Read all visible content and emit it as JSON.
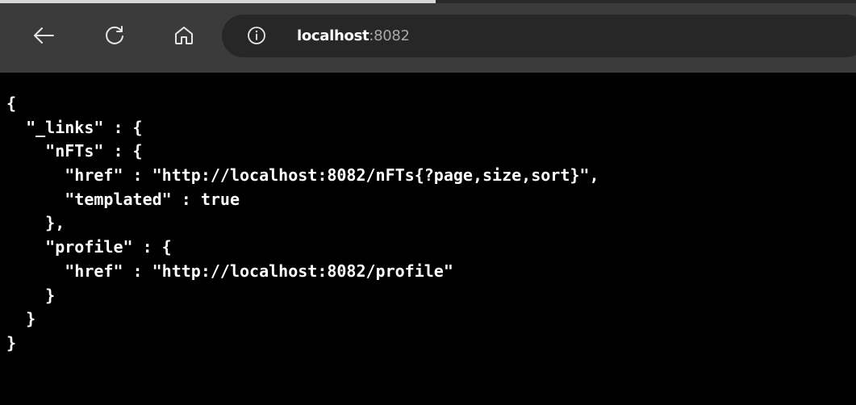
{
  "browser": {
    "back_icon": "arrow-left-icon",
    "refresh_icon": "refresh-icon",
    "home_icon": "home-icon",
    "info_icon": "info-icon",
    "address": {
      "host": "localhost",
      "separator": ":",
      "port": "8082"
    },
    "colors": {
      "toolbar": "#3b3b3b",
      "address_bar": "#272727",
      "page_background": "#000000",
      "text": "#ffffff",
      "port_text": "#a8a8a8"
    }
  },
  "json_lines": [
    "{",
    "  \"_links\" : {",
    "    \"nFTs\" : {",
    "      \"href\" : \"http://localhost:8082/nFTs{?page,size,sort}\",",
    "      \"templated\" : true",
    "    },",
    "    \"profile\" : {",
    "      \"href\" : \"http://localhost:8082/profile\"",
    "    }",
    "  }",
    "}"
  ]
}
